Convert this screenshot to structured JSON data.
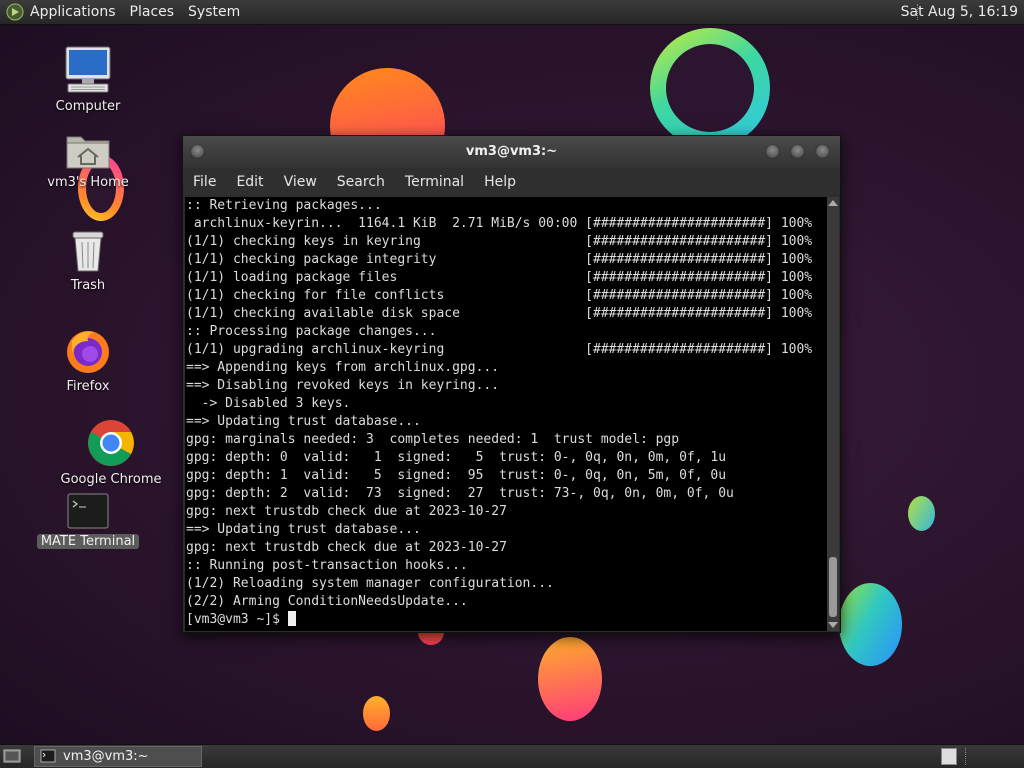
{
  "top_panel": {
    "menus": [
      "Applications",
      "Places",
      "System"
    ],
    "clock": "Sat Aug  5, 16:19"
  },
  "desktop_icons": [
    {
      "label": "Computer",
      "icon": "computer-icon"
    },
    {
      "label": "vm3's Home",
      "icon": "home-folder-icon"
    },
    {
      "label": "Trash",
      "icon": "trash-icon"
    },
    {
      "label": "Firefox",
      "icon": "firefox-icon"
    },
    {
      "label": "Google Chrome",
      "icon": "chrome-icon"
    },
    {
      "label": "MATE Terminal",
      "icon": "terminal-icon"
    }
  ],
  "terminal": {
    "title": "vm3@vm3:~",
    "menu": [
      "File",
      "Edit",
      "View",
      "Search",
      "Terminal",
      "Help"
    ],
    "lines": [
      ":: Retrieving packages...",
      " archlinux-keyrin...  1164.1 KiB  2.71 MiB/s 00:00 [######################] 100%",
      "(1/1) checking keys in keyring                     [######################] 100%",
      "(1/1) checking package integrity                   [######################] 100%",
      "(1/1) loading package files                        [######################] 100%",
      "(1/1) checking for file conflicts                  [######################] 100%",
      "(1/1) checking available disk space                [######################] 100%",
      ":: Processing package changes...",
      "(1/1) upgrading archlinux-keyring                  [######################] 100%",
      "==> Appending keys from archlinux.gpg...",
      "==> Disabling revoked keys in keyring...",
      "  -> Disabled 3 keys.",
      "==> Updating trust database...",
      "gpg: marginals needed: 3  completes needed: 1  trust model: pgp",
      "gpg: depth: 0  valid:   1  signed:   5  trust: 0-, 0q, 0n, 0m, 0f, 1u",
      "gpg: depth: 1  valid:   5  signed:  95  trust: 0-, 0q, 0n, 5m, 0f, 0u",
      "gpg: depth: 2  valid:  73  signed:  27  trust: 73-, 0q, 0n, 0m, 0f, 0u",
      "gpg: next trustdb check due at 2023-10-27",
      "==> Updating trust database...",
      "gpg: next trustdb check due at 2023-10-27",
      ":: Running post-transaction hooks...",
      "(1/2) Reloading system manager configuration...",
      "(2/2) Arming ConditionNeedsUpdate..."
    ],
    "prompt": "[vm3@vm3 ~]$ "
  },
  "taskbar": {
    "items": [
      {
        "label": "vm3@vm3:~",
        "icon": "terminal-icon"
      }
    ]
  }
}
